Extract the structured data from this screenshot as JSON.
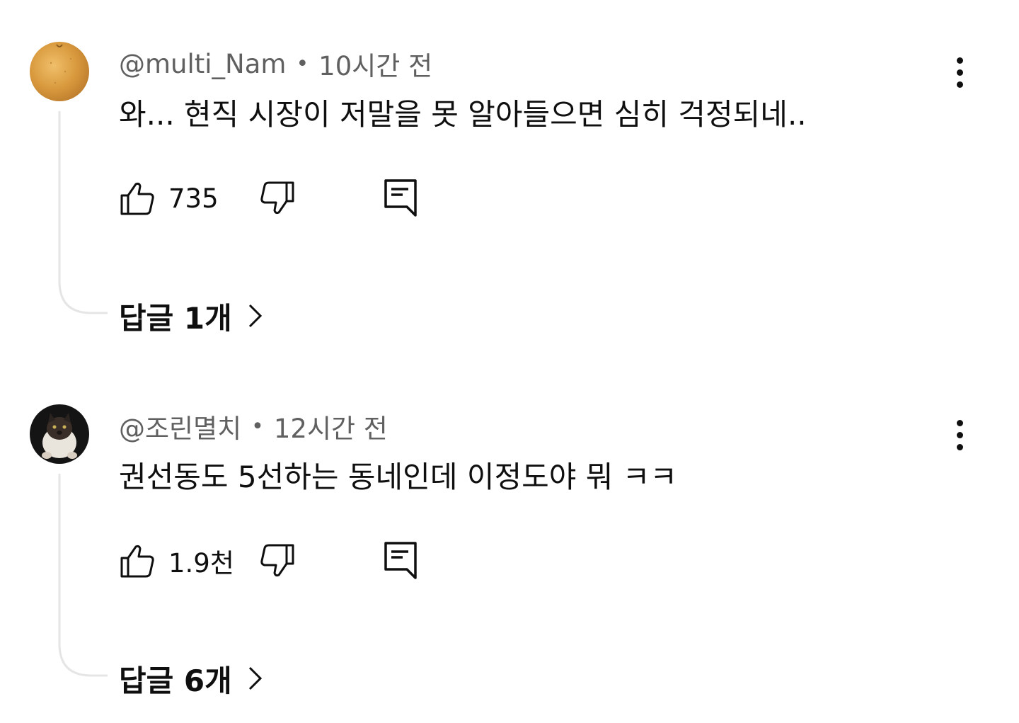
{
  "colors": {
    "text_primary": "#0f0f0f",
    "text_secondary": "#606060",
    "thread_line": "#e5e5e5",
    "background": "#ffffff"
  },
  "comments": [
    {
      "author": "@multi_Nam",
      "separator": "•",
      "time": "10시간 전",
      "text": "와... 현직 시장이 저말을 못 알아들으면 심히 걱정되네..",
      "likes": "735",
      "replies_label": "답글 1개",
      "avatar_icon": "pear-avatar-icon"
    },
    {
      "author": "@조린멸치",
      "separator": "•",
      "time": "12시간 전",
      "text": "권선동도 5선하는 동네인데 이정도야 뭐 ㅋㅋ",
      "likes": "1.9천",
      "replies_label": "답글 6개",
      "avatar_icon": "cat-avatar-icon"
    }
  ],
  "icons": {
    "like": "thumbs-up-icon",
    "dislike": "thumbs-down-icon",
    "reply": "reply-comment-icon",
    "more": "more-vertical-icon",
    "chevron": "chevron-right-icon"
  }
}
